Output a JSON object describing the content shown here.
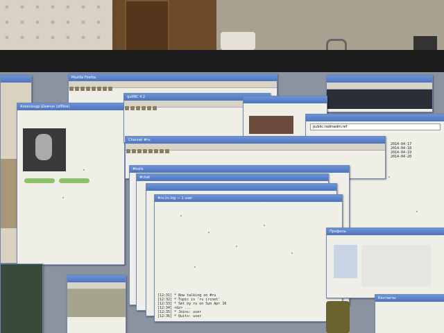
{
  "windows": {
    "chat": {
      "title": "Александр Шевчук (offline)"
    },
    "main1": {
      "title": "Mozilla Firefox"
    },
    "main2": {
      "title": "qutIRC 4.2"
    },
    "browser": {
      "title": "public.radmadm.ref",
      "url": "public.radmadm.ref"
    },
    "stack1": {
      "title": "Channel #ru"
    },
    "stack2": {
      "title": "#kalis"
    },
    "stack3": {
      "title": "#chat"
    },
    "irc": {
      "title": "#ru.irc.log — 1 user"
    },
    "profile": {
      "title": "Профиль"
    },
    "contacts": {
      "title": "Контакты"
    }
  },
  "irc_log": [
    "[12:31] * Now talking on #ru",
    "[12:32] * Topic is 'ru ircnet'",
    "[12:33] * Set by ru on Sun Apr 16",
    "[12:34] <dz> ...",
    "[12:35] * Joins: user",
    "[12:36] * Quits: user"
  ],
  "dates": [
    "2014-04-17",
    "2014-04-18",
    "2014-04-19",
    "2014-04-20"
  ],
  "colors": {
    "titlebar": "#5a80c8",
    "screen_bg": "#8c93a0"
  }
}
